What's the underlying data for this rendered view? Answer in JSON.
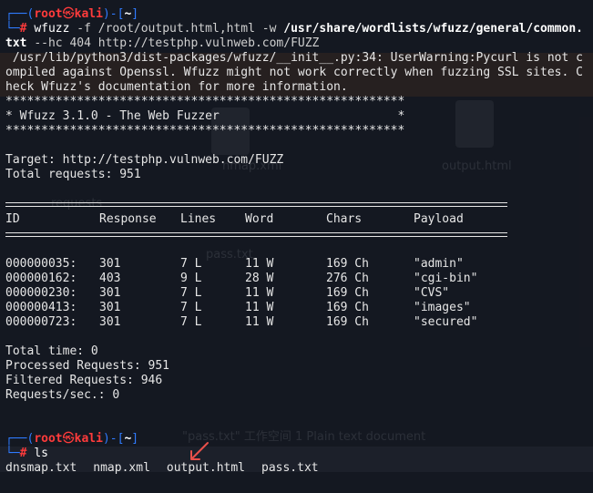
{
  "prompt1": {
    "user": "root",
    "host": "kali",
    "dir": "~",
    "hash": "#",
    "command": "wfuzz",
    "args_part1": "-f /root/output.html,html -w",
    "wordlist": "/usr/share/wordlists/wfuzz/general/common.txt",
    "args_part2": "--hc 404 http://testphp.vulnweb.com/FUZZ"
  },
  "warning_text": " /usr/lib/python3/dist-packages/wfuzz/__init__.py:34: UserWarning:Pycurl is not compiled against Openssl. Wfuzz might not work correctly when fuzzing SSL sites. Check Wfuzz's documentation for more information.",
  "banner": {
    "stars": "********************************************************",
    "title": "* Wfuzz 3.1.0 - The Web Fuzzer                         *"
  },
  "target_line": "Target: http://testphp.vulnweb.com/FUZZ",
  "total_requests_line": "Total requests: 951",
  "table": {
    "headers": [
      "ID",
      "Response",
      "Lines",
      "Word",
      "Chars",
      "Payload"
    ],
    "rows": [
      [
        "000000035:",
        "301",
        "7 L",
        "11 W",
        "169 Ch",
        "\"admin\""
      ],
      [
        "000000162:",
        "403",
        "9 L",
        "28 W",
        "276 Ch",
        "\"cgi-bin\""
      ],
      [
        "000000230:",
        "301",
        "7 L",
        "11 W",
        "169 Ch",
        "\"CVS\""
      ],
      [
        "000000413:",
        "301",
        "7 L",
        "11 W",
        "169 Ch",
        "\"images\""
      ],
      [
        "000000723:",
        "301",
        "7 L",
        "11 W",
        "169 Ch",
        "\"secured\""
      ]
    ]
  },
  "stats": {
    "total_time": "Total time: 0",
    "processed": "Processed Requests: 951",
    "filtered": "Filtered Requests: 946",
    "rate": "Requests/sec.: 0"
  },
  "prompt2": {
    "user": "root",
    "host": "kali",
    "dir": "~",
    "hash": "#",
    "command": "ls"
  },
  "ls_output": [
    "dnsmap.txt",
    "nmap.xml",
    "output.html",
    "pass.txt"
  ],
  "ghost": {
    "nmap": "nmap.xml",
    "output": "output.html",
    "requests": "requests",
    "pass": "pass.txt",
    "doc": "\"pass.txt\" 工作空间 1 Plain text document"
  },
  "colors": {
    "prompt_frame": "#2f7bff",
    "prompt_user": "#ff3b3b",
    "arrow": "#e8504a"
  }
}
